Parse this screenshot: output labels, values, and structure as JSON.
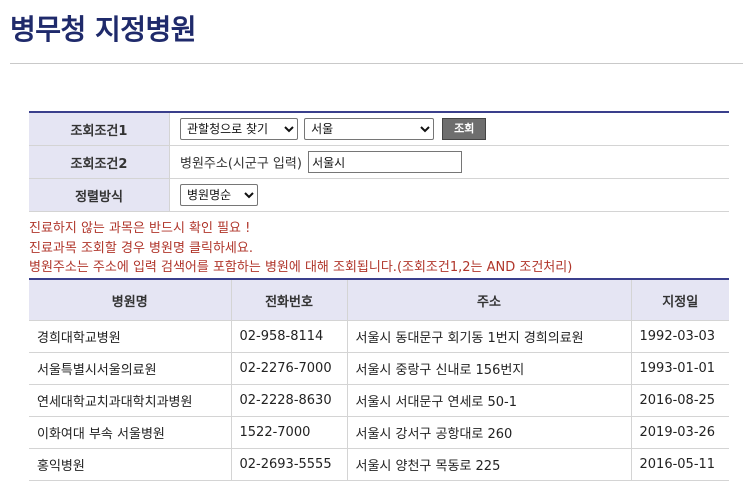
{
  "page": {
    "title": "병무청 지정병원"
  },
  "search": {
    "cond1_label": "조회조건1",
    "cond1_type_selected": "관할청으로 찾기",
    "cond1_region_selected": "서울",
    "search_button": "조회",
    "cond2_label": "조회조건2",
    "cond2_text": "병원주소(시군구 입력)",
    "cond2_value": "서울시",
    "sort_label": "정렬방식",
    "sort_selected": "병원명순"
  },
  "notes": [
    "진료하지 않는 과목은 반드시 확인 필요 !",
    "진료과목 조회할 경우 병원명 클릭하세요.",
    "병원주소는 주소에 입력 검색어를 포함하는 병원에 대해 조회됩니다.(조회조건1,2는 AND 조건처리)"
  ],
  "table": {
    "headers": [
      "병원명",
      "전화번호",
      "주소",
      "지정일"
    ],
    "rows": [
      [
        "경희대학교병원",
        "02-958-8114",
        "서울시 동대문구 회기동 1번지 경희의료원",
        "1992-03-03"
      ],
      [
        "서울특별시서울의료원",
        "02-2276-7000",
        "서울시 중랑구 신내로 156번지",
        "1993-01-01"
      ],
      [
        "연세대학교치과대학치과병원",
        "02-2228-8630",
        "서울시 서대문구 연세로 50-1",
        "2016-08-25"
      ],
      [
        "이화여대 부속 서울병원",
        "1522-7000",
        "서울시 강서구 공항대로 260",
        "2019-03-26"
      ],
      [
        "홍익병원",
        "02-2693-5555",
        "서울시 양천구 목동로 225",
        "2016-05-11"
      ]
    ]
  },
  "colors": {
    "title": "#1f2a6b",
    "header_bg": "#e5e5f3",
    "note_text": "#b0362b",
    "table_top_border": "#3a3f8c"
  }
}
